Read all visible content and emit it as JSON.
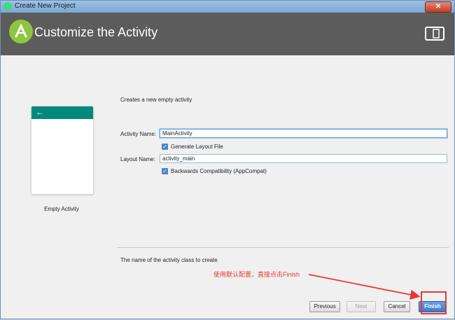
{
  "window": {
    "title": "Create New Project"
  },
  "header": {
    "title": "Customize the Activity"
  },
  "template": {
    "name": "Empty Activity",
    "back_arrow": "←"
  },
  "form": {
    "description": "Creates a new empty activity",
    "activity_name_label": "Activity Name:",
    "activity_name_value": "MainActivity",
    "generate_layout_label": "Generate Layout File",
    "generate_layout_checked": true,
    "layout_name_label": "Layout Name:",
    "layout_name_value": "activity_main",
    "backwards_compat_label": "Backwards Compatibility (AppCompat)",
    "backwards_compat_checked": true
  },
  "hint": "The name of the activity class to create",
  "annotation": "使用默认配置，直接点击Finish",
  "buttons": {
    "previous": "Previous",
    "next": "Next",
    "cancel": "Cancel",
    "finish": "Finish"
  },
  "colors": {
    "header": "#5c5c5c",
    "preview_bar": "#00897b",
    "annotation": "#e53935",
    "primary": "#4f86c6"
  }
}
